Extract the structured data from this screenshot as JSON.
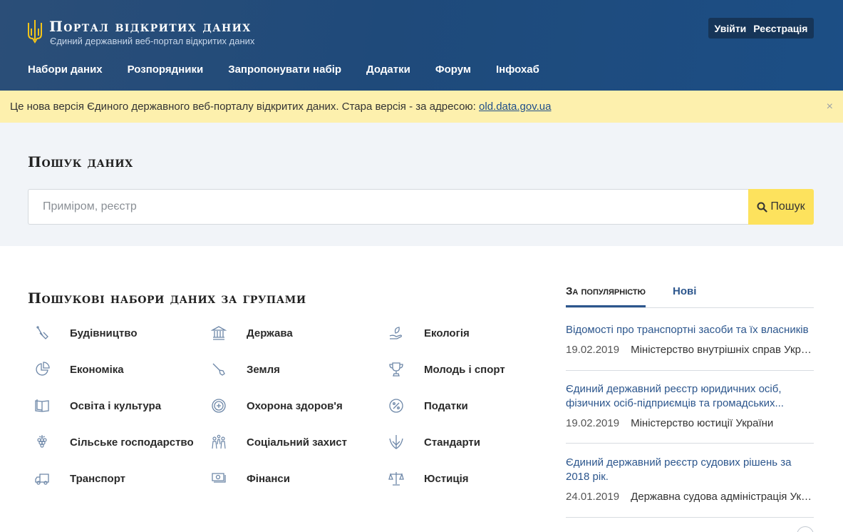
{
  "header": {
    "title": "Портал відкритих даних",
    "subtitle": "Єдиний державний веб-портал відкритих даних",
    "login": "Увійти",
    "register": "Реєстрація",
    "nav": [
      "Набори даних",
      "Розпорядники",
      "Запропонувати набір",
      "Додатки",
      "Форум",
      "Інфохаб"
    ]
  },
  "notice": {
    "text": "Це нова версія Єдиного державного веб-порталу відкритих даних. Стара версія - за адресою: ",
    "link": "old.data.gov.ua",
    "close": "×"
  },
  "search": {
    "title": "Пошук даних",
    "placeholder": "Приміром, реєстр",
    "button": "Пошук"
  },
  "groups": {
    "title": "Пошукові набори даних за групами",
    "items": [
      {
        "label": "Будівництво",
        "icon": "construction-icon"
      },
      {
        "label": "Держава",
        "icon": "government-building-icon"
      },
      {
        "label": "Екологія",
        "icon": "ecology-hand-leaf-icon"
      },
      {
        "label": "Економіка",
        "icon": "pie-chart-icon"
      },
      {
        "label": "Земля",
        "icon": "shovel-icon"
      },
      {
        "label": "Молодь і спорт",
        "icon": "trophy-icon"
      },
      {
        "label": "Освіта і культура",
        "icon": "book-icon"
      },
      {
        "label": "Охорона здоров'я",
        "icon": "health-target-icon"
      },
      {
        "label": "Податки",
        "icon": "percent-icon"
      },
      {
        "label": "Сільське господарство",
        "icon": "grapes-icon"
      },
      {
        "label": "Соціальний захист",
        "icon": "family-icon"
      },
      {
        "label": "Стандарти",
        "icon": "trident-icon"
      },
      {
        "label": "Транспорт",
        "icon": "truck-icon"
      },
      {
        "label": "Фінанси",
        "icon": "money-icon"
      },
      {
        "label": "Юстиція",
        "icon": "scales-icon"
      }
    ]
  },
  "popular": {
    "tab_popular": "За популярністю",
    "tab_new": "Нові",
    "items": [
      {
        "title": "Відомості про транспортні засоби та їх власників",
        "date": "19.02.2019",
        "org": "Міністерство внутрішніх справ Укра..."
      },
      {
        "title": "Єдиний державний реєстр юридичних осіб, фізичних осіб-підприємців та громадських...",
        "date": "19.02.2019",
        "org": "Міністерство юстиції України"
      },
      {
        "title": "Єдиний державний реєстр судових рішень за 2018 рік.",
        "date": "24.01.2019",
        "org": "Державна судова адміністрація Укр..."
      }
    ]
  },
  "colors": {
    "header_bg": "#1f4a7a",
    "notice_bg": "#fdf0ad",
    "search_button": "#fde25d",
    "link": "#2c568d"
  }
}
